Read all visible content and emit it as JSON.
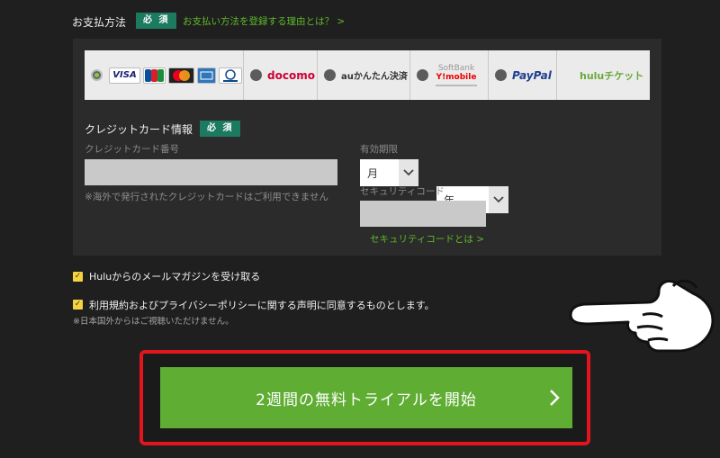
{
  "header": {
    "label": "お支払方法",
    "required": "必 須",
    "link": "お支払い方法を登録する理由とは？ >"
  },
  "payment_methods": [
    {
      "name": "credit-card",
      "logos": [
        "VISA",
        "JCB",
        "MasterCard",
        "AMEX",
        "Diners Club"
      ],
      "selected": true
    },
    {
      "name": "docomo",
      "label": "docomo"
    },
    {
      "name": "au",
      "label": "auかんたん決済"
    },
    {
      "name": "softbank",
      "label": "SoftBank",
      "sub": "Y!mobile"
    },
    {
      "name": "paypal",
      "label": "PayPal"
    },
    {
      "name": "hulu-ticket",
      "label": "huluチケット"
    }
  ],
  "card": {
    "title": "クレジットカード情報",
    "required": "必 須",
    "number_label": "クレジットカード番号",
    "number_note": "※海外で発行されたクレジットカードはご利用できません",
    "expiry_label": "有効期限",
    "month": "月",
    "year": "年",
    "security_label": "セキュリティコード",
    "security_link": "セキュリティコードとは >"
  },
  "options": {
    "newsletter": "Huluからのメールマガジンを受け取る",
    "terms": "利用規約およびプライバシーポリシーに関する声明に同意するものとします。",
    "note": "※日本国外からはご視聴いただけません。"
  },
  "cta": {
    "label": "2週間の無料トライアルを開始"
  },
  "colors": {
    "accent": "#5fad33",
    "badge": "#1b7a60",
    "highlight": "#e3151c"
  }
}
